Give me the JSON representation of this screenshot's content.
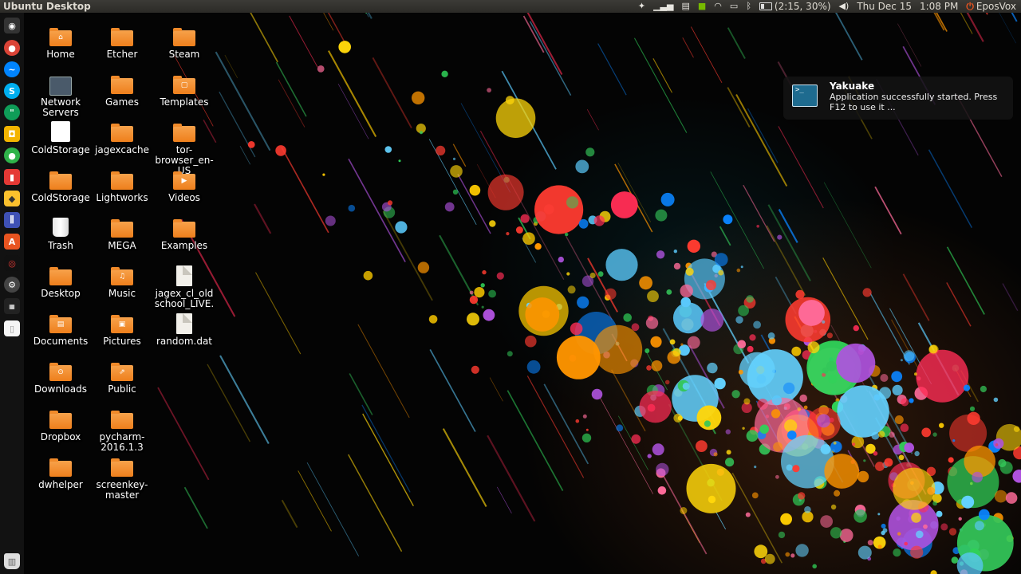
{
  "panel": {
    "title": "Ubuntu Desktop",
    "battery": "(2:15, 30%)",
    "date": "Thu Dec 15",
    "time": "1:08 PM",
    "user": "EposVox"
  },
  "launcher": {
    "items": [
      {
        "icon": "dash-home-icon"
      },
      {
        "icon": "chrome-icon"
      },
      {
        "icon": "messenger-icon"
      },
      {
        "icon": "skype-icon"
      },
      {
        "icon": "hangouts-icon"
      },
      {
        "icon": "discord-icon"
      },
      {
        "icon": "app-green-icon"
      },
      {
        "icon": "app-red-icon"
      },
      {
        "icon": "app-yellow-icon"
      },
      {
        "icon": "mixer-icon"
      },
      {
        "icon": "software-center-icon"
      },
      {
        "icon": "app-dark-icon"
      },
      {
        "icon": "settings-icon"
      },
      {
        "icon": "workspace-icon"
      },
      {
        "icon": "blank-doc-icon"
      },
      {
        "icon": "trash-icon"
      }
    ]
  },
  "desktop": {
    "col1": [
      {
        "label": "Home",
        "type": "folder",
        "emblem": "⌂"
      },
      {
        "label": "Network Servers",
        "type": "network"
      },
      {
        "label": "ColdStorage",
        "type": "whitedoc"
      },
      {
        "label": "ColdStorage",
        "type": "folder",
        "emblem": ""
      },
      {
        "label": "Trash",
        "type": "trash"
      },
      {
        "label": "Desktop",
        "type": "folder",
        "emblem": ""
      },
      {
        "label": "Documents",
        "type": "folder",
        "emblem": "▤"
      },
      {
        "label": "Downloads",
        "type": "folder",
        "emblem": "⊙"
      },
      {
        "label": "Dropbox",
        "type": "folder",
        "emblem": ""
      },
      {
        "label": "dwhelper",
        "type": "folder",
        "emblem": ""
      }
    ],
    "col2": [
      {
        "label": "Etcher",
        "type": "folder",
        "emblem": ""
      },
      {
        "label": "Games",
        "type": "folder",
        "emblem": ""
      },
      {
        "label": "jagexcache",
        "type": "folder",
        "emblem": ""
      },
      {
        "label": "Lightworks",
        "type": "folder",
        "emblem": ""
      },
      {
        "label": "MEGA",
        "type": "folder",
        "emblem": ""
      },
      {
        "label": "Music",
        "type": "folder",
        "emblem": "♫"
      },
      {
        "label": "Pictures",
        "type": "folder",
        "emblem": "▣"
      },
      {
        "label": "Public",
        "type": "folder",
        "emblem": "⇗"
      },
      {
        "label": "pycharm-2016.1.3",
        "type": "folder",
        "emblem": ""
      },
      {
        "label": "screenkey-master",
        "type": "folder",
        "emblem": ""
      }
    ],
    "col3": [
      {
        "label": "Steam",
        "type": "folder",
        "emblem": ""
      },
      {
        "label": "Templates",
        "type": "folder",
        "emblem": "▢"
      },
      {
        "label": "tor-browser_en-US",
        "type": "folder",
        "emblem": ""
      },
      {
        "label": "Videos",
        "type": "folder",
        "emblem": "▶"
      },
      {
        "label": "Examples",
        "type": "folder",
        "emblem": ""
      },
      {
        "label": "jagex_cl_oldschool_LIVE....",
        "type": "file"
      },
      {
        "label": "random.dat",
        "type": "file"
      }
    ]
  },
  "notification": {
    "title": "Yakuake",
    "body": "Application successfully started. Press F12 to use it ...",
    "icon": ">_"
  },
  "colors": {
    "accent": "#e95420",
    "folder": "#f08a2a",
    "panel": "#3c3b37"
  }
}
